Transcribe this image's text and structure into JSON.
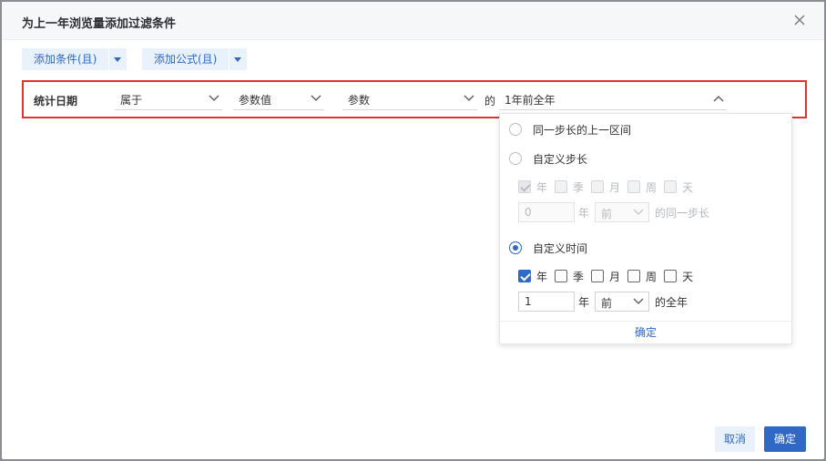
{
  "dialog": {
    "title": "为上一年浏览量添加过滤条件"
  },
  "toolbar": {
    "add_condition": "添加条件(且)",
    "add_formula": "添加公式(且)"
  },
  "condition": {
    "field_label": "统计日期",
    "operator": "属于",
    "value_type": "参数值",
    "parameter": "参数",
    "connector": "的",
    "date_value": "1年前全年"
  },
  "popup": {
    "option_same_step": "同一步长的上一区间",
    "option_custom_step": "自定义步长",
    "custom_step": {
      "units": [
        {
          "label": "年",
          "checked": true
        },
        {
          "label": "季",
          "checked": false
        },
        {
          "label": "月",
          "checked": false
        },
        {
          "label": "周",
          "checked": false
        },
        {
          "label": "天",
          "checked": false
        }
      ],
      "amount": "0",
      "amount_unit": "年",
      "direction": "前",
      "suffix": "的同一步长"
    },
    "option_custom_time": "自定义时间",
    "custom_time": {
      "units": [
        {
          "label": "年",
          "checked": true
        },
        {
          "label": "季",
          "checked": false
        },
        {
          "label": "月",
          "checked": false
        },
        {
          "label": "周",
          "checked": false
        },
        {
          "label": "天",
          "checked": false
        }
      ],
      "amount": "1",
      "amount_unit": "年",
      "direction": "前",
      "suffix": "的全年"
    },
    "selected_option": "custom_time",
    "confirm": "确定"
  },
  "footer": {
    "cancel": "取消",
    "ok": "确定"
  },
  "colors": {
    "accent": "#2f68c5",
    "highlight_border": "#e0342f"
  }
}
